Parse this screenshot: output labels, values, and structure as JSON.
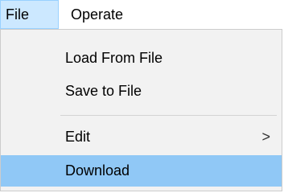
{
  "menubar": {
    "items": [
      {
        "label": "File"
      },
      {
        "label": "Operate"
      }
    ]
  },
  "file_menu": {
    "items": [
      {
        "label": "Load From File"
      },
      {
        "label": "Save to File"
      },
      {
        "label": "Edit",
        "submenu_indicator": ">"
      },
      {
        "label": "Download",
        "highlighted": true
      }
    ]
  },
  "colors": {
    "menubar_active_bg": "#cce8ff",
    "menu_bg": "#f2f2f2",
    "highlight_bg": "#90c8f6"
  }
}
